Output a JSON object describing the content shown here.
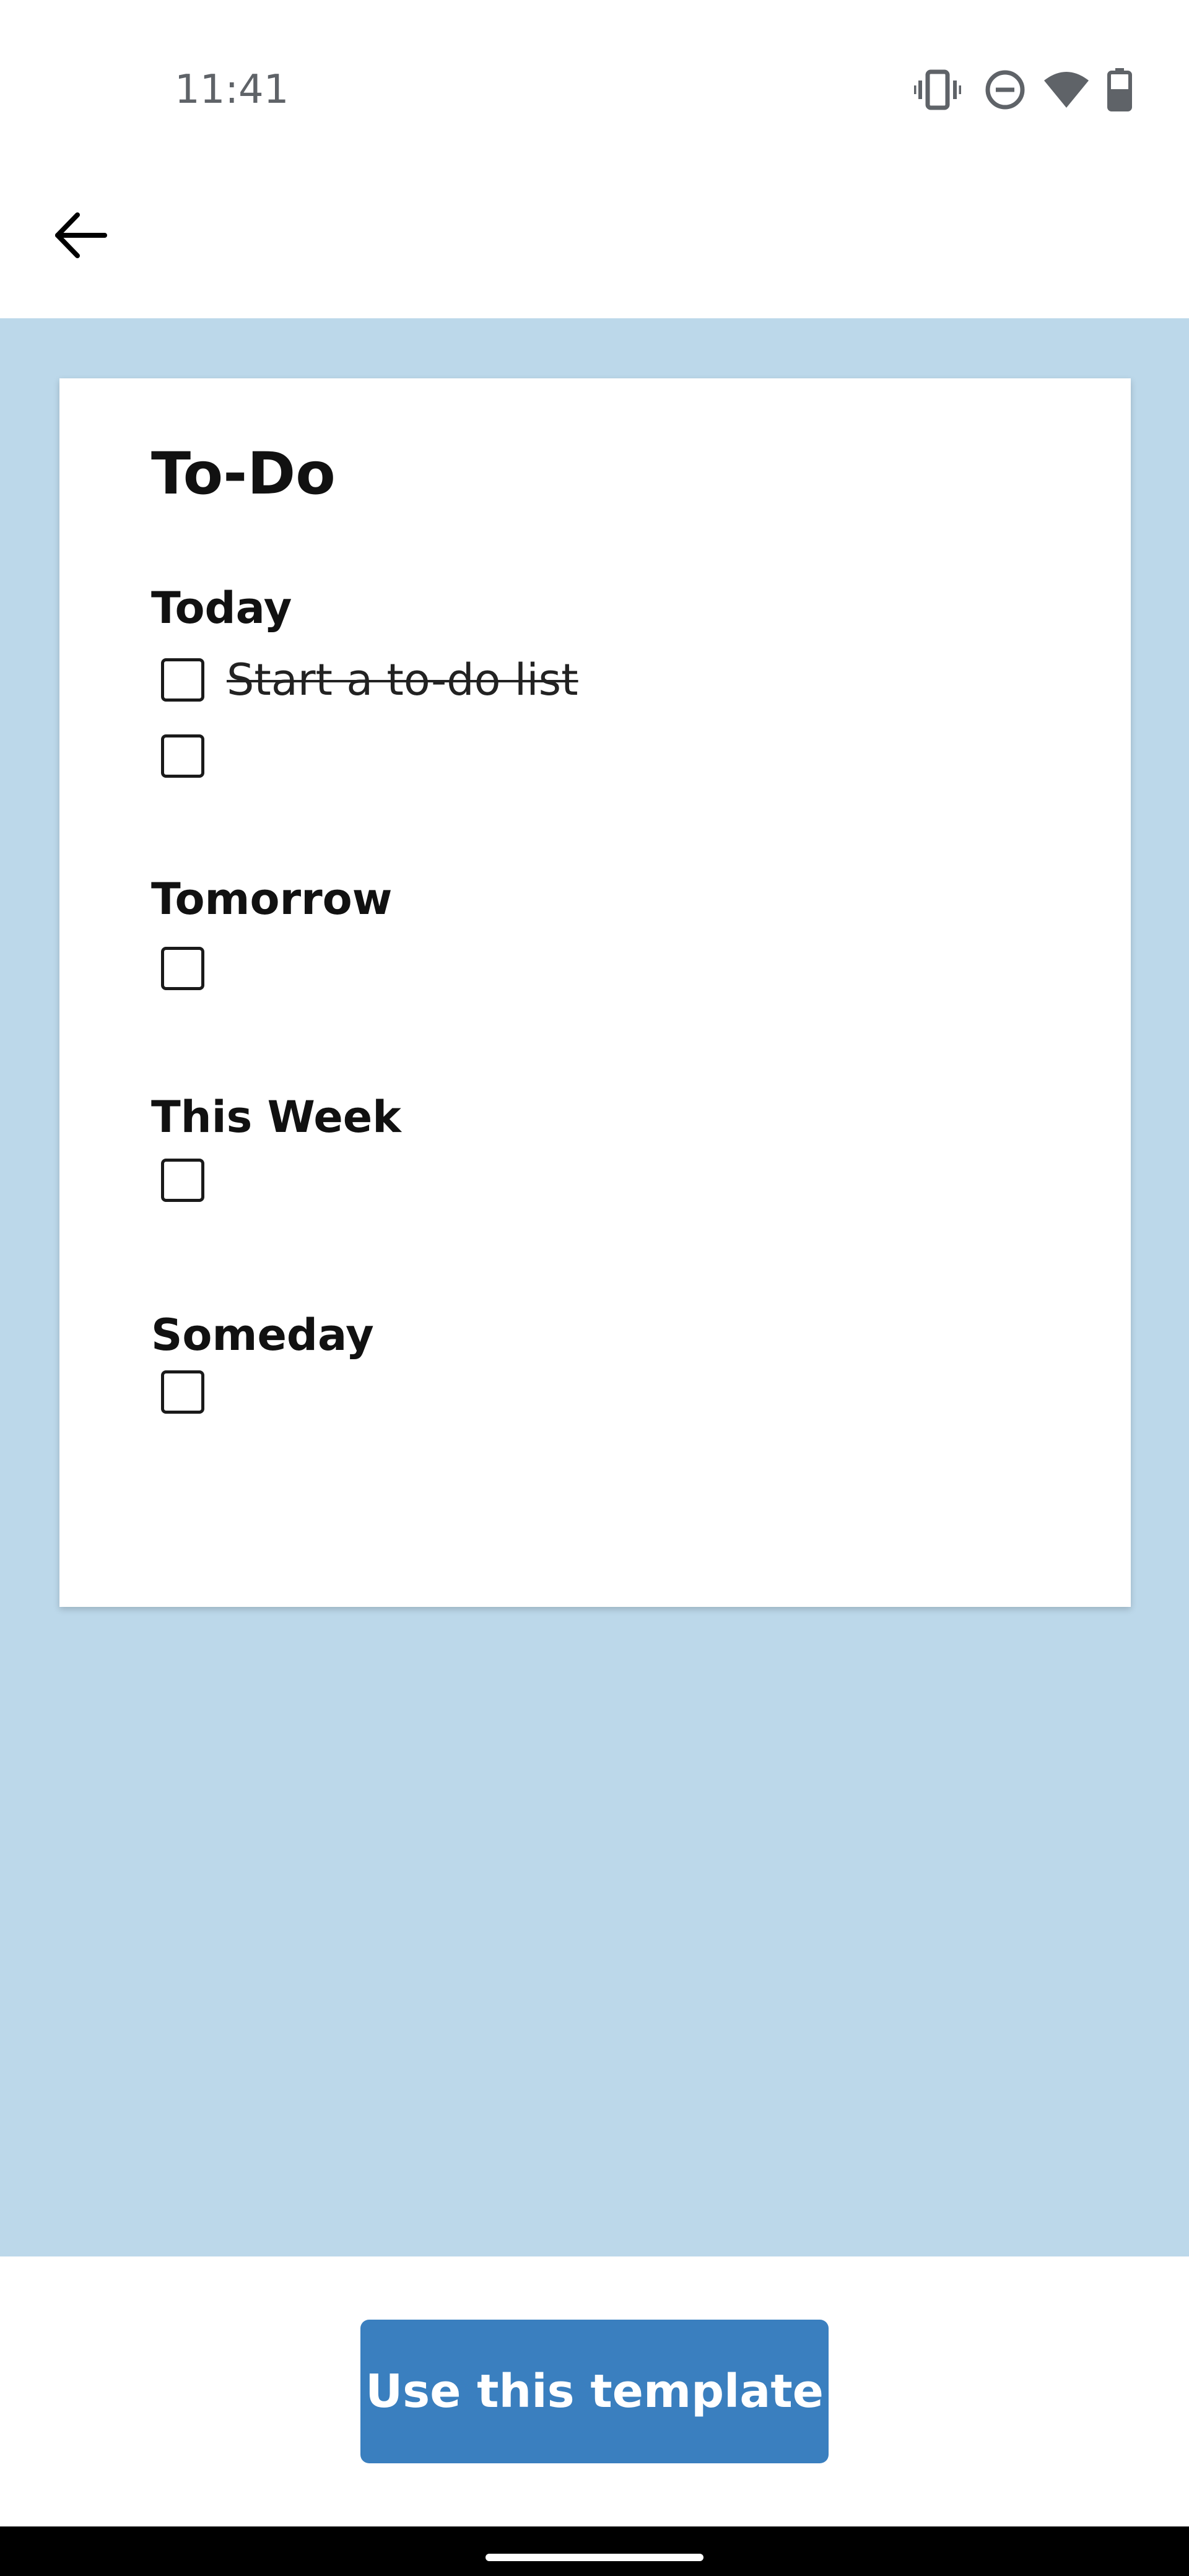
{
  "status_bar": {
    "time": "11:41",
    "icons": [
      "vibrate-icon",
      "do-not-disturb-icon",
      "wifi-icon",
      "battery-icon"
    ]
  },
  "toolbar": {
    "back_icon": "arrow-back-icon"
  },
  "colors": {
    "preview_background": "#bcd8ea",
    "button": "#3a7fbf"
  },
  "template": {
    "title": "To-Do",
    "sections": [
      {
        "heading": "Today",
        "items": [
          {
            "text": "Start a to-do list",
            "done": true
          },
          {
            "text": "",
            "done": false
          }
        ]
      },
      {
        "heading": "Tomorrow",
        "items": [
          {
            "text": "",
            "done": false
          }
        ]
      },
      {
        "heading": "This Week",
        "items": [
          {
            "text": "",
            "done": false
          }
        ]
      },
      {
        "heading": "Someday",
        "items": [
          {
            "text": "",
            "done": false
          }
        ]
      }
    ]
  },
  "actions": {
    "use_template_label": "Use this template"
  }
}
